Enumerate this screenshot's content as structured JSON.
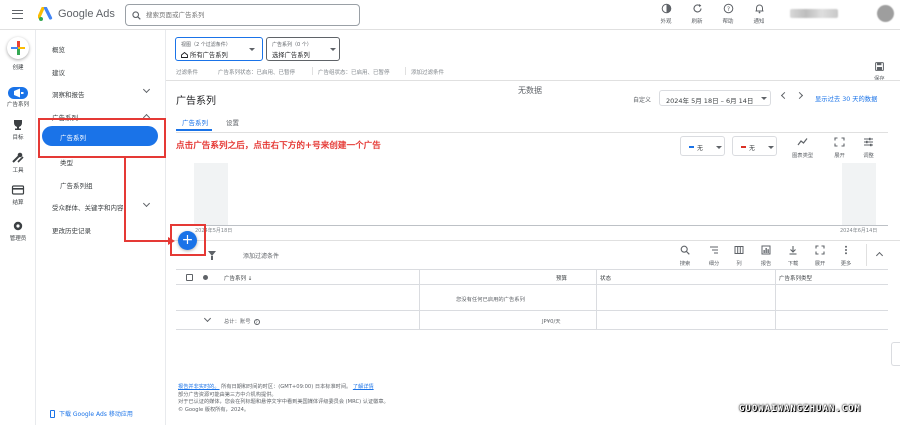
{
  "topbar": {
    "brand": "Google Ads",
    "search_placeholder": "搜索页面或广告系列",
    "actions": [
      {
        "icon": "appearance-icon",
        "label": "外观"
      },
      {
        "icon": "refresh-icon",
        "label": "刷新"
      },
      {
        "icon": "help-icon",
        "label": "帮助"
      },
      {
        "icon": "bell-icon",
        "label": "通知"
      }
    ]
  },
  "rail": {
    "create_label": "创建",
    "items": [
      {
        "icon": "campaigns-icon",
        "label": "广告系列"
      },
      {
        "icon": "goals-icon",
        "label": "目标"
      },
      {
        "icon": "tools-icon",
        "label": "工具"
      },
      {
        "icon": "billing-icon",
        "label": "结算"
      },
      {
        "icon": "admin-icon",
        "label": "管理员"
      }
    ]
  },
  "subnav": {
    "overview": "概览",
    "recommendations": "建议",
    "insights": "洞察和报告",
    "campaigns_group": "广告系列",
    "campaigns_active": "广告系列",
    "ad_groups_partial": "类型",
    "campaign_groups": "广告系列组",
    "audiences": "受众群体、关键字和内容",
    "change_history": "更改历史记录",
    "mobile_app": "下载 Google Ads 移动应用"
  },
  "filters": {
    "view_small": "视图（2 个过滤条件）",
    "view_main": "所有广告系列",
    "campaign_small": "广告系列（0 个）",
    "campaign_main": "选择广告系列",
    "line_label": "过滤条件",
    "chip1": "广告系列状态：已启用、已暂停",
    "chip2": "广告组状态：已启用、已暂停",
    "add": "添加过滤条件",
    "save": "保存"
  },
  "page": {
    "title": "广告系列",
    "date_label": "自定义",
    "date_range": "2024年 5月 18日 – 6月 14日",
    "last_days": "显示过去 30 天的数据",
    "tabs": [
      "广告系列",
      "设置"
    ]
  },
  "chart": {
    "no_data": "无数据",
    "select1": "无",
    "select2": "无",
    "tools": [
      {
        "icon": "chart-type-icon",
        "label": "图表类型"
      },
      {
        "icon": "expand-icon",
        "label": "展开"
      },
      {
        "icon": "adjust-icon",
        "label": "调整"
      }
    ],
    "start_date": "2024年5月18日",
    "end_date": "2024年6月14日",
    "colors": {
      "series1": "#1a73e8",
      "series2": "#d93025"
    }
  },
  "table_toolbar": {
    "add_filter": "添加过滤条件",
    "tools": [
      {
        "icon": "search-icon",
        "label": "搜索"
      },
      {
        "icon": "segment-icon",
        "label": "细分"
      },
      {
        "icon": "columns-icon",
        "label": "列"
      },
      {
        "icon": "report-icon",
        "label": "报告"
      },
      {
        "icon": "download-icon",
        "label": "下载"
      },
      {
        "icon": "expand-icon",
        "label": "展开"
      },
      {
        "icon": "more-icon",
        "label": "更多"
      }
    ]
  },
  "table": {
    "headers": [
      "广告系列",
      "预算",
      "状态",
      "广告系列类型"
    ],
    "empty_message": "您没有任何已启用的广告系列",
    "total_label": "总计：账号",
    "total_budget": "JP¥0/天"
  },
  "footer": {
    "line1_link": "报告并非实时的。",
    "line1_rest": "所有日期和时间的时区：(GMT+09:00) 日本标准时间。",
    "line1_link2": "了解详情",
    "line2": "部分广告资源可能由第三方中介机构提供。",
    "line3": "对于已认证的媒体，您会在列标题和悬停文字中看到美国媒体评级委员会 (MRC) 认证徽章。",
    "line4": "© Google 版权所有，2024。"
  },
  "annotation": {
    "text": "点击广告系列之后，点击右下方的+号来创建一个广告",
    "color": "#e53935"
  },
  "watermark": "GUOWAIWANGZHUAN.COM",
  "fab_symbol": "+"
}
